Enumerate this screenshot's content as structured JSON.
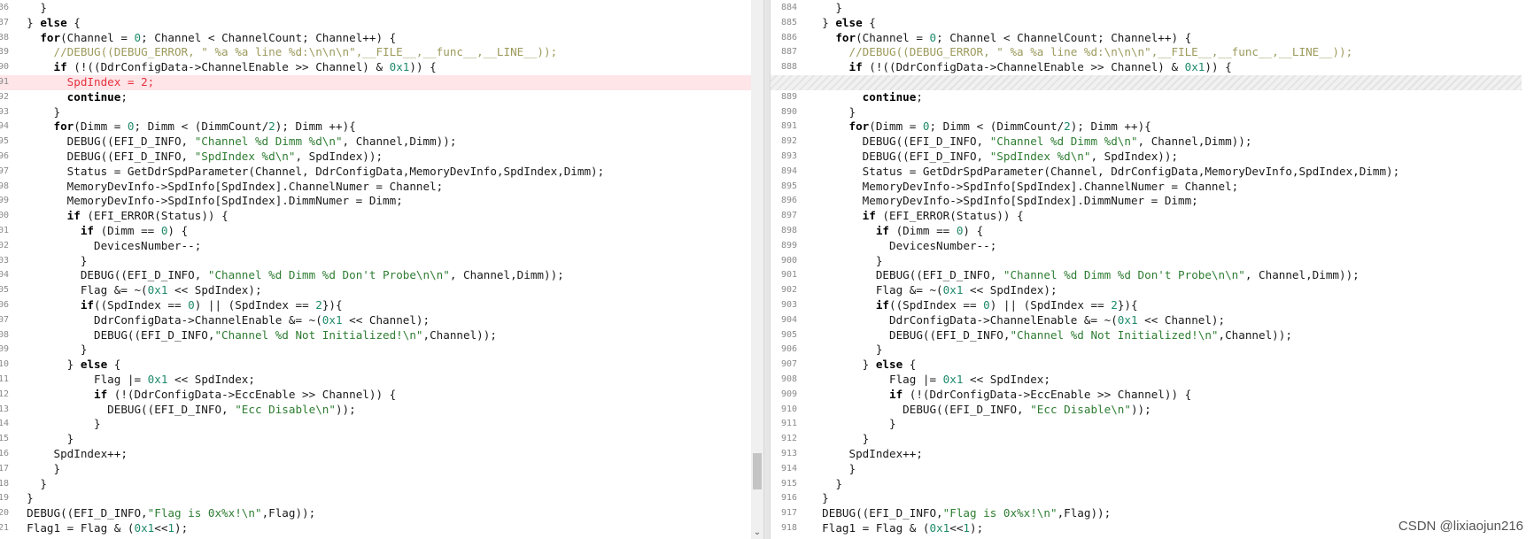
{
  "watermark": "CSDN @lixiaojun216",
  "scroll": {
    "left_down_arrow": "⌄",
    "left_thumb_fraction_start": 0.86,
    "left_thumb_fraction_size": 0.07
  },
  "left_pane": {
    "lines": [
      {
        "num": "36",
        "tokens": [
          [
            "t",
            "    }"
          ]
        ]
      },
      {
        "num": "37",
        "tokens": [
          [
            "t",
            "  } "
          ],
          [
            "k",
            "else"
          ],
          [
            "t",
            " {"
          ]
        ]
      },
      {
        "num": "38",
        "tokens": [
          [
            "t",
            "    "
          ],
          [
            "k",
            "for"
          ],
          [
            "t",
            "(Channel = "
          ],
          [
            "n",
            "0"
          ],
          [
            "t",
            "; Channel < ChannelCount; Channel++) {"
          ]
        ]
      },
      {
        "num": "39",
        "tokens": [
          [
            "t",
            "      "
          ],
          [
            "c",
            "//DEBUG((DEBUG_ERROR, \" %a %a line %d:\\n\\n\\n\",__FILE__,__func__,__LINE__));"
          ]
        ]
      },
      {
        "num": "90",
        "tokens": [
          [
            "t",
            "      "
          ],
          [
            "k",
            "if"
          ],
          [
            "t",
            " (!((DdrConfigData->ChannelEnable >> Channel) & "
          ],
          [
            "n",
            "0x1"
          ],
          [
            "t",
            ")) {"
          ]
        ]
      },
      {
        "num": "91",
        "state": "removed",
        "tokens": [
          [
            "t",
            "        SpdIndex = "
          ],
          [
            "n",
            "2"
          ],
          [
            "t",
            ";"
          ]
        ]
      },
      {
        "num": "92",
        "tokens": [
          [
            "t",
            "        "
          ],
          [
            "k",
            "continue"
          ],
          [
            "t",
            ";"
          ]
        ]
      },
      {
        "num": "93",
        "tokens": [
          [
            "t",
            "      }"
          ]
        ]
      },
      {
        "num": "94",
        "tokens": [
          [
            "t",
            "      "
          ],
          [
            "k",
            "for"
          ],
          [
            "t",
            "(Dimm = "
          ],
          [
            "n",
            "0"
          ],
          [
            "t",
            "; Dimm < (DimmCount/"
          ],
          [
            "n",
            "2"
          ],
          [
            "t",
            "); Dimm ++){"
          ]
        ]
      },
      {
        "num": "95",
        "tokens": [
          [
            "t",
            "        DEBUG((EFI_D_INFO, "
          ],
          [
            "s",
            "\"Channel %d Dimm %d\\n\""
          ],
          [
            "t",
            ", Channel,Dimm));"
          ]
        ]
      },
      {
        "num": "96",
        "tokens": [
          [
            "t",
            "        DEBUG((EFI_D_INFO, "
          ],
          [
            "s",
            "\"SpdIndex %d\\n\""
          ],
          [
            "t",
            ", SpdIndex));"
          ]
        ]
      },
      {
        "num": "97",
        "tokens": [
          [
            "t",
            "        Status = GetDdrSpdParameter(Channel, DdrConfigData,MemoryDevInfo,SpdIndex,Dimm);"
          ]
        ]
      },
      {
        "num": "98",
        "tokens": [
          [
            "t",
            "        MemoryDevInfo->SpdInfo[SpdIndex].ChannelNumer = Channel;"
          ]
        ]
      },
      {
        "num": "99",
        "tokens": [
          [
            "t",
            "        MemoryDevInfo->SpdInfo[SpdIndex].DimmNumer = Dimm;"
          ]
        ]
      },
      {
        "num": "00",
        "tokens": [
          [
            "t",
            "        "
          ],
          [
            "k",
            "if"
          ],
          [
            "t",
            " (EFI_ERROR(Status)) {"
          ]
        ]
      },
      {
        "num": "01",
        "tokens": [
          [
            "t",
            "          "
          ],
          [
            "k",
            "if"
          ],
          [
            "t",
            " (Dimm == "
          ],
          [
            "n",
            "0"
          ],
          [
            "t",
            ") {"
          ]
        ]
      },
      {
        "num": "02",
        "tokens": [
          [
            "t",
            "            DevicesNumber--;"
          ]
        ]
      },
      {
        "num": "03",
        "tokens": [
          [
            "t",
            "          }"
          ]
        ]
      },
      {
        "num": "04",
        "tokens": [
          [
            "t",
            "          DEBUG((EFI_D_INFO, "
          ],
          [
            "s",
            "\"Channel %d Dimm %d Don't Probe\\n\\n\""
          ],
          [
            "t",
            ", Channel,Dimm));"
          ]
        ]
      },
      {
        "num": "05",
        "tokens": [
          [
            "t",
            "          Flag &= ~("
          ],
          [
            "n",
            "0x1"
          ],
          [
            "t",
            " << SpdIndex);"
          ]
        ]
      },
      {
        "num": "06",
        "tokens": [
          [
            "t",
            "          "
          ],
          [
            "k",
            "if"
          ],
          [
            "t",
            "((SpdIndex == "
          ],
          [
            "n",
            "0"
          ],
          [
            "t",
            ") || (SpdIndex == "
          ],
          [
            "n",
            "2"
          ],
          [
            "t",
            "}){"
          ]
        ]
      },
      {
        "num": "07",
        "tokens": [
          [
            "t",
            "            DdrConfigData->ChannelEnable &= ~("
          ],
          [
            "n",
            "0x1"
          ],
          [
            "t",
            " << Channel);"
          ]
        ]
      },
      {
        "num": "08",
        "tokens": [
          [
            "t",
            "            DEBUG((EFI_D_INFO,"
          ],
          [
            "s",
            "\"Channel %d Not Initialized!\\n\""
          ],
          [
            "t",
            ",Channel));"
          ]
        ]
      },
      {
        "num": "09",
        "tokens": [
          [
            "t",
            "          }"
          ]
        ]
      },
      {
        "num": "10",
        "tokens": [
          [
            "t",
            "        } "
          ],
          [
            "k",
            "else"
          ],
          [
            "t",
            " {"
          ]
        ]
      },
      {
        "num": "11",
        "tokens": [
          [
            "t",
            "            Flag |= "
          ],
          [
            "n",
            "0x1"
          ],
          [
            "t",
            " << SpdIndex;"
          ]
        ]
      },
      {
        "num": "12",
        "tokens": [
          [
            "t",
            "            "
          ],
          [
            "k",
            "if"
          ],
          [
            "t",
            " (!(DdrConfigData->EccEnable >> Channel)) {"
          ]
        ]
      },
      {
        "num": "13",
        "tokens": [
          [
            "t",
            "              DEBUG((EFI_D_INFO, "
          ],
          [
            "s",
            "\"Ecc Disable\\n\""
          ],
          [
            "t",
            "));"
          ]
        ]
      },
      {
        "num": "14",
        "tokens": [
          [
            "t",
            "            }"
          ]
        ]
      },
      {
        "num": "15",
        "tokens": [
          [
            "t",
            "        }"
          ]
        ]
      },
      {
        "num": "16",
        "tokens": [
          [
            "t",
            "      SpdIndex++;"
          ]
        ]
      },
      {
        "num": "17",
        "tokens": [
          [
            "t",
            "      }"
          ]
        ]
      },
      {
        "num": "18",
        "tokens": [
          [
            "t",
            "    }"
          ]
        ]
      },
      {
        "num": "19",
        "tokens": [
          [
            "t",
            "  }"
          ]
        ]
      },
      {
        "num": "20",
        "tokens": [
          [
            "t",
            "  DEBUG((EFI_D_INFO,"
          ],
          [
            "s",
            "\"Flag is 0x%x!\\n\""
          ],
          [
            "t",
            ",Flag));"
          ]
        ]
      },
      {
        "num": "21",
        "tokens": [
          [
            "t",
            "  Flag1 = Flag & ("
          ],
          [
            "n",
            "0x1"
          ],
          [
            "t",
            "<<"
          ],
          [
            "n",
            "1"
          ],
          [
            "t",
            ");"
          ]
        ]
      }
    ]
  },
  "right_pane": {
    "lines": [
      {
        "num": "884",
        "tokens": [
          [
            "t",
            "    }"
          ]
        ]
      },
      {
        "num": "885",
        "tokens": [
          [
            "t",
            "  } "
          ],
          [
            "k",
            "else"
          ],
          [
            "t",
            " {"
          ]
        ]
      },
      {
        "num": "886",
        "tokens": [
          [
            "t",
            "    "
          ],
          [
            "k",
            "for"
          ],
          [
            "t",
            "(Channel = "
          ],
          [
            "n",
            "0"
          ],
          [
            "t",
            "; Channel < ChannelCount; Channel++) {"
          ]
        ]
      },
      {
        "num": "887",
        "tokens": [
          [
            "t",
            "      "
          ],
          [
            "c",
            "//DEBUG((DEBUG_ERROR, \" %a %a line %d:\\n\\n\\n\",__FILE__,__func__,__LINE__));"
          ]
        ]
      },
      {
        "num": "888",
        "tokens": [
          [
            "t",
            "      "
          ],
          [
            "k",
            "if"
          ],
          [
            "t",
            " (!((DdrConfigData->ChannelEnable >> Channel) & "
          ],
          [
            "n",
            "0x1"
          ],
          [
            "t",
            ")) {"
          ]
        ]
      },
      {
        "num": "",
        "state": "placeholder",
        "tokens": []
      },
      {
        "num": "889",
        "tokens": [
          [
            "t",
            "        "
          ],
          [
            "k",
            "continue"
          ],
          [
            "t",
            ";"
          ]
        ]
      },
      {
        "num": "890",
        "tokens": [
          [
            "t",
            "      }"
          ]
        ]
      },
      {
        "num": "891",
        "tokens": [
          [
            "t",
            "      "
          ],
          [
            "k",
            "for"
          ],
          [
            "t",
            "(Dimm = "
          ],
          [
            "n",
            "0"
          ],
          [
            "t",
            "; Dimm < (DimmCount/"
          ],
          [
            "n",
            "2"
          ],
          [
            "t",
            "); Dimm ++){"
          ]
        ]
      },
      {
        "num": "892",
        "tokens": [
          [
            "t",
            "        DEBUG((EFI_D_INFO, "
          ],
          [
            "s",
            "\"Channel %d Dimm %d\\n\""
          ],
          [
            "t",
            ", Channel,Dimm));"
          ]
        ]
      },
      {
        "num": "893",
        "tokens": [
          [
            "t",
            "        DEBUG((EFI_D_INFO, "
          ],
          [
            "s",
            "\"SpdIndex %d\\n\""
          ],
          [
            "t",
            ", SpdIndex));"
          ]
        ]
      },
      {
        "num": "894",
        "tokens": [
          [
            "t",
            "        Status = GetDdrSpdParameter(Channel, DdrConfigData,MemoryDevInfo,SpdIndex,Dimm);"
          ]
        ]
      },
      {
        "num": "895",
        "tokens": [
          [
            "t",
            "        MemoryDevInfo->SpdInfo[SpdIndex].ChannelNumer = Channel;"
          ]
        ]
      },
      {
        "num": "896",
        "tokens": [
          [
            "t",
            "        MemoryDevInfo->SpdInfo[SpdIndex].DimmNumer = Dimm;"
          ]
        ]
      },
      {
        "num": "897",
        "tokens": [
          [
            "t",
            "        "
          ],
          [
            "k",
            "if"
          ],
          [
            "t",
            " (EFI_ERROR(Status)) {"
          ]
        ]
      },
      {
        "num": "898",
        "tokens": [
          [
            "t",
            "          "
          ],
          [
            "k",
            "if"
          ],
          [
            "t",
            " (Dimm == "
          ],
          [
            "n",
            "0"
          ],
          [
            "t",
            ") {"
          ]
        ]
      },
      {
        "num": "899",
        "tokens": [
          [
            "t",
            "            DevicesNumber--;"
          ]
        ]
      },
      {
        "num": "900",
        "tokens": [
          [
            "t",
            "          }"
          ]
        ]
      },
      {
        "num": "901",
        "tokens": [
          [
            "t",
            "          DEBUG((EFI_D_INFO, "
          ],
          [
            "s",
            "\"Channel %d Dimm %d Don't Probe\\n\\n\""
          ],
          [
            "t",
            ", Channel,Dimm));"
          ]
        ]
      },
      {
        "num": "902",
        "tokens": [
          [
            "t",
            "          Flag &= ~("
          ],
          [
            "n",
            "0x1"
          ],
          [
            "t",
            " << SpdIndex);"
          ]
        ]
      },
      {
        "num": "903",
        "tokens": [
          [
            "t",
            "          "
          ],
          [
            "k",
            "if"
          ],
          [
            "t",
            "((SpdIndex == "
          ],
          [
            "n",
            "0"
          ],
          [
            "t",
            ") || (SpdIndex == "
          ],
          [
            "n",
            "2"
          ],
          [
            "t",
            "}){"
          ]
        ]
      },
      {
        "num": "904",
        "tokens": [
          [
            "t",
            "            DdrConfigData->ChannelEnable &= ~("
          ],
          [
            "n",
            "0x1"
          ],
          [
            "t",
            " << Channel);"
          ]
        ]
      },
      {
        "num": "905",
        "tokens": [
          [
            "t",
            "            DEBUG((EFI_D_INFO,"
          ],
          [
            "s",
            "\"Channel %d Not Initialized!\\n\""
          ],
          [
            "t",
            ",Channel));"
          ]
        ]
      },
      {
        "num": "906",
        "tokens": [
          [
            "t",
            "          }"
          ]
        ]
      },
      {
        "num": "907",
        "tokens": [
          [
            "t",
            "        } "
          ],
          [
            "k",
            "else"
          ],
          [
            "t",
            " {"
          ]
        ]
      },
      {
        "num": "908",
        "tokens": [
          [
            "t",
            "            Flag |= "
          ],
          [
            "n",
            "0x1"
          ],
          [
            "t",
            " << SpdIndex;"
          ]
        ]
      },
      {
        "num": "909",
        "tokens": [
          [
            "t",
            "            "
          ],
          [
            "k",
            "if"
          ],
          [
            "t",
            " (!(DdrConfigData->EccEnable >> Channel)) {"
          ]
        ]
      },
      {
        "num": "910",
        "tokens": [
          [
            "t",
            "              DEBUG((EFI_D_INFO, "
          ],
          [
            "s",
            "\"Ecc Disable\\n\""
          ],
          [
            "t",
            "));"
          ]
        ]
      },
      {
        "num": "911",
        "tokens": [
          [
            "t",
            "            }"
          ]
        ]
      },
      {
        "num": "912",
        "tokens": [
          [
            "t",
            "        }"
          ]
        ]
      },
      {
        "num": "913",
        "tokens": [
          [
            "t",
            "      SpdIndex++;"
          ]
        ]
      },
      {
        "num": "914",
        "tokens": [
          [
            "t",
            "      }"
          ]
        ]
      },
      {
        "num": "915",
        "tokens": [
          [
            "t",
            "    }"
          ]
        ]
      },
      {
        "num": "916",
        "tokens": [
          [
            "t",
            "  }"
          ]
        ]
      },
      {
        "num": "917",
        "tokens": [
          [
            "t",
            "  DEBUG((EFI_D_INFO,"
          ],
          [
            "s",
            "\"Flag is 0x%x!\\n\""
          ],
          [
            "t",
            ",Flag));"
          ]
        ]
      },
      {
        "num": "918",
        "tokens": [
          [
            "t",
            "  Flag1 = Flag & ("
          ],
          [
            "n",
            "0x1"
          ],
          [
            "t",
            "<<"
          ],
          [
            "n",
            "1"
          ],
          [
            "t",
            ");"
          ]
        ]
      }
    ]
  },
  "colors": {
    "removed_bg": "#fde5e8",
    "removed_text": "#e8313e",
    "string": "#2e7d32",
    "number": "#1e8a6a",
    "comment": "#9c9a5c",
    "arrow_fill": "#f2d04a",
    "arrow_stroke": "#b8901a"
  }
}
